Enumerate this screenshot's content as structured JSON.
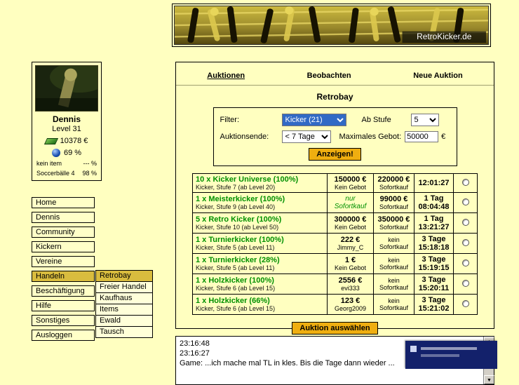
{
  "banner": {
    "brand": "RetroKicker.de"
  },
  "profile": {
    "name": "Dennis",
    "level": "Level 31",
    "money": "10378 €",
    "mood": "69 %",
    "item_label": "kein item",
    "item_value": "--- %",
    "balls_label": "Soccerbälle 4",
    "balls_value": "98 %"
  },
  "sidebar": {
    "items": [
      "Home",
      "Dennis",
      "Community",
      "Kickern",
      "Vereine",
      "Handeln",
      "Beschäftigung",
      "Hilfe",
      "Sonstiges",
      "Ausloggen"
    ],
    "active": "Handeln"
  },
  "submenu": {
    "items": [
      "Retrobay",
      "Freier Handel",
      "Kaufhaus",
      "Items",
      "Ewald",
      "Tausch"
    ],
    "active": "Retrobay"
  },
  "tabs": {
    "items": [
      "Auktionen",
      "Beobachten",
      "Neue Auktion"
    ],
    "active": "Auktionen"
  },
  "page_title": "Retrobay",
  "filter": {
    "filter_label": "Filter:",
    "filter_value": "Kicker (21)",
    "stufe_label": "Ab Stufe",
    "stufe_value": "5",
    "ende_label": "Auktionsende:",
    "ende_value": "< 7 Tage",
    "gebot_label": "Maximales Gebot:",
    "gebot_value": "50000",
    "currency": "€",
    "submit_label": "Anzeigen!"
  },
  "auctions": {
    "rows": [
      {
        "name": "10 x Kicker Universe (100%)",
        "desc": "Kicker, Stufe 7 (ab Level 20)",
        "bid": "150000 €",
        "bid_sub": "Kein Gebot",
        "buy": "220000 €",
        "buy_sub": "Sofortkauf",
        "time1": "12:01:27",
        "time2": ""
      },
      {
        "name": "1 x Meisterkicker (100%)",
        "desc": "Kicker, Stufe 9 (ab Level 40)",
        "bid_note": "nur Sofortkauf",
        "buy": "99000 €",
        "buy_sub": "Sofortkauf",
        "time1": "1 Tag",
        "time2": "08:04:48"
      },
      {
        "name": "5 x Retro Kicker (100%)",
        "desc": "Kicker, Stufe 10 (ab Level 50)",
        "bid": "300000 €",
        "bid_sub": "Kein Gebot",
        "buy": "350000 €",
        "buy_sub": "Sofortkauf",
        "time1": "1 Tag",
        "time2": "13:21:27"
      },
      {
        "name": "1 x Turnierkicker (100%)",
        "desc": "Kicker, Stufe 5 (ab Level 11)",
        "bid": "222 €",
        "bid_sub": "Jimmy_C",
        "buy": "kein",
        "buy_sub": "Sofortkauf",
        "time1": "3 Tage",
        "time2": "15:18:18"
      },
      {
        "name": "1 x Turnierkicker (28%)",
        "desc": "Kicker, Stufe 5 (ab Level 11)",
        "bid": "1 €",
        "bid_sub": "Kein Gebot",
        "buy": "kein",
        "buy_sub": "Sofortkauf",
        "time1": "3 Tage",
        "time2": "15:19:15"
      },
      {
        "name": "1 x Holzkicker (100%)",
        "desc": "Kicker, Stufe 6 (ab Level 15)",
        "bid": "2556 €",
        "bid_sub": "evi333",
        "buy": "kein",
        "buy_sub": "Sofortkauf",
        "time1": "3 Tage",
        "time2": "15:20:11"
      },
      {
        "name": "1 x Holzkicker (66%)",
        "desc": "Kicker, Stufe 6 (ab Level 15)",
        "bid": "123 €",
        "bid_sub": "Georg2009",
        "buy": "kein",
        "buy_sub": "Sofortkauf",
        "time1": "3 Tage",
        "time2": "15:21:02"
      }
    ],
    "select_label": "Auktion auswählen"
  },
  "chat": {
    "lines": [
      "23:16:48",
      "23:16:27",
      "Game: ...ich mache mal TL in kles. Bis die Tage dann wieder ..."
    ]
  },
  "colors": {
    "accent_gold": "#d9bc3e",
    "button_gold": "#efae10",
    "item_green": "#009000",
    "popup_navy": "#13216b"
  }
}
